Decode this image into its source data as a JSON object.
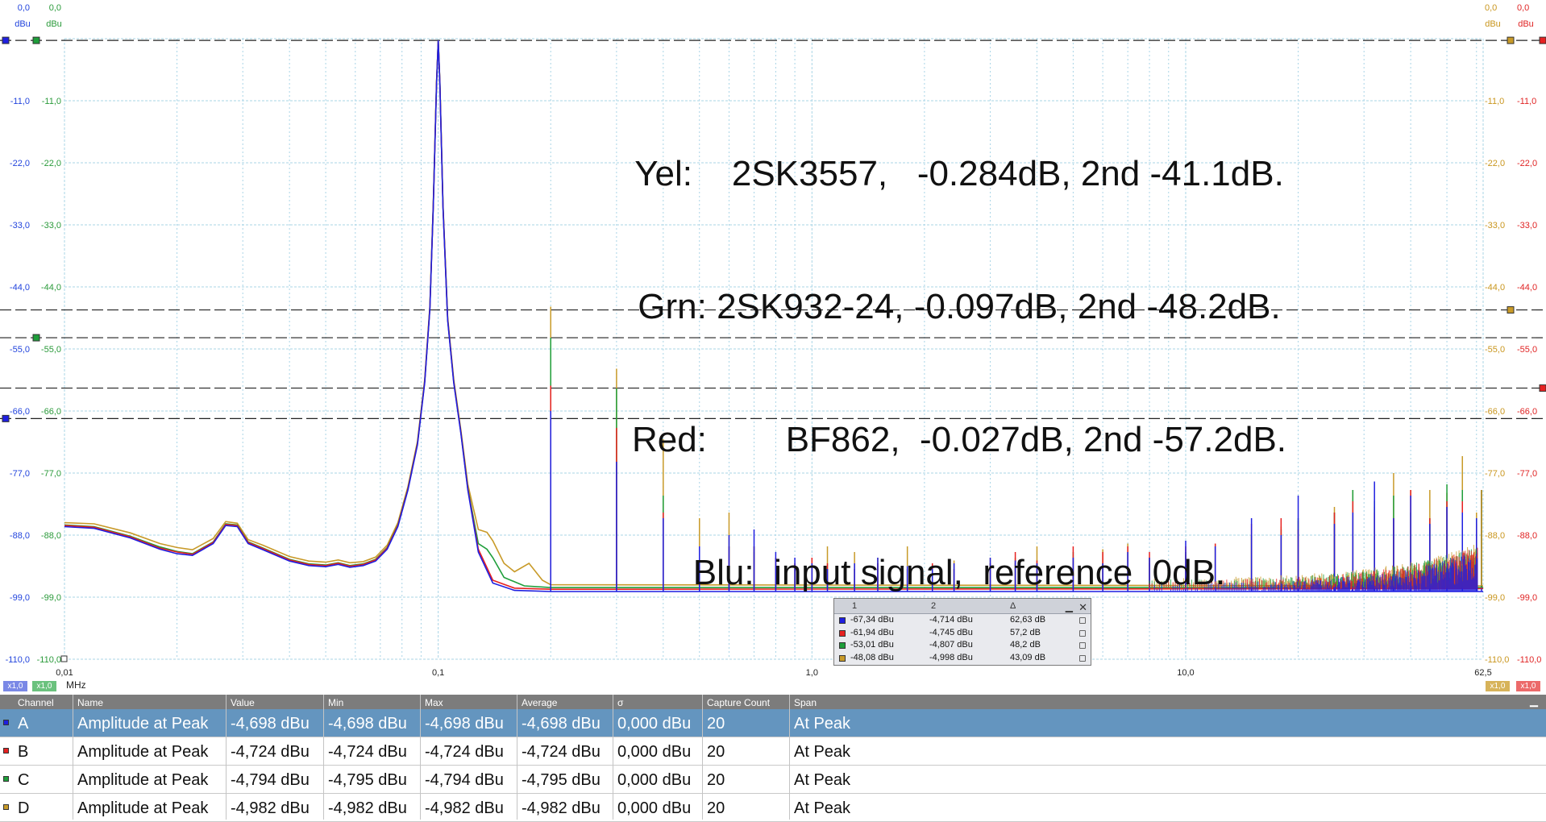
{
  "annotation": {
    "lines": [
      "Yel:    2SK3557,   -0.284dB, 2nd -41.1dB.",
      "Grn: 2SK932-24, -0.097dB, 2nd -48.2dB.",
      "Red:        BF862,  -0.027dB, 2nd -57.2dB.",
      "Blu:  input signal,  reference  0dB."
    ]
  },
  "colors": {
    "A": "#1f1fe0",
    "B": "#e62020",
    "C": "#1e9e3a",
    "D": "#c89a28",
    "left_axis_a": "#2244dd",
    "left_axis_c": "#2a9a3a",
    "right_axis_d": "#c9961e",
    "right_axis_b": "#e02424",
    "grid": "#a9d4e6",
    "table_selected": "#6495bf"
  },
  "chart_data": {
    "type": "line",
    "title": "",
    "xlabel": "MHz",
    "ylabel": "dBu",
    "x_scale": "log",
    "xlim": [
      0.01,
      62.5
    ],
    "ylim": [
      -110,
      0
    ],
    "grid": true,
    "x_tick_labels": [
      "0,01",
      "0,1",
      "1,0",
      "10,0",
      "62,5"
    ],
    "x_ticks": [
      0.01,
      0.1,
      1.0,
      10.0,
      62.5
    ],
    "y_ticks": [
      0,
      -11,
      -22,
      -33,
      -44,
      -55,
      -66,
      -77,
      -88,
      -99,
      -110
    ],
    "y_tick_labels": [
      "0,0",
      "-11,0",
      "-22,0",
      "-33,0",
      "-44,0",
      "-55,0",
      "-66,0",
      "-77,0",
      "-88,0",
      "-99,0",
      "-110,0"
    ],
    "left_axis_units": [
      "dBu",
      "dBu"
    ],
    "right_axis_units": [
      "dBu",
      "dBu"
    ],
    "left_scale_pills": [
      "x1,0",
      "x1,0"
    ],
    "right_scale_pills": [
      "x1,0",
      "x1,0"
    ],
    "noise_floor": {
      "A": -98,
      "B": -97.5,
      "C": -97.3,
      "D": -97.0
    },
    "fundamental": {
      "x": 0.1,
      "y": -0.3
    },
    "series": [
      {
        "id": "A",
        "points": [
          [
            0.01,
            -86.5
          ],
          [
            0.012,
            -86.8
          ],
          [
            0.015,
            -88.5
          ],
          [
            0.018,
            -90.5
          ],
          [
            0.02,
            -91.3
          ],
          [
            0.022,
            -91.6
          ],
          [
            0.025,
            -89.5
          ],
          [
            0.027,
            -86.3
          ],
          [
            0.029,
            -86.5
          ],
          [
            0.031,
            -89.5
          ],
          [
            0.034,
            -90.6
          ],
          [
            0.04,
            -92.6
          ],
          [
            0.045,
            -93.4
          ],
          [
            0.05,
            -93.6
          ],
          [
            0.054,
            -93.2
          ],
          [
            0.058,
            -93.7
          ],
          [
            0.063,
            -93.4
          ],
          [
            0.068,
            -92.6
          ],
          [
            0.073,
            -90.5
          ],
          [
            0.078,
            -86.5
          ],
          [
            0.083,
            -80.0
          ],
          [
            0.088,
            -72.0
          ],
          [
            0.092,
            -61.0
          ],
          [
            0.095,
            -48.0
          ],
          [
            0.097,
            -30.0
          ],
          [
            0.099,
            -8.0
          ],
          [
            0.1,
            -0.3
          ],
          [
            0.101,
            -8.0
          ],
          [
            0.103,
            -30.0
          ],
          [
            0.106,
            -50.0
          ],
          [
            0.11,
            -61.0
          ],
          [
            0.115,
            -70.0
          ],
          [
            0.12,
            -80.0
          ],
          [
            0.128,
            -91.0
          ],
          [
            0.14,
            -96.5
          ],
          [
            0.16,
            -97.8
          ],
          [
            0.2,
            -98.0
          ],
          [
            62.5,
            -98.0
          ]
        ]
      },
      {
        "id": "B",
        "points": [
          [
            0.01,
            -86.3
          ],
          [
            0.012,
            -86.6
          ],
          [
            0.015,
            -88.3
          ],
          [
            0.018,
            -90.3
          ],
          [
            0.02,
            -91.0
          ],
          [
            0.022,
            -91.4
          ],
          [
            0.025,
            -89.3
          ],
          [
            0.027,
            -86.1
          ],
          [
            0.029,
            -86.3
          ],
          [
            0.031,
            -89.3
          ],
          [
            0.034,
            -90.4
          ],
          [
            0.04,
            -92.4
          ],
          [
            0.045,
            -93.2
          ],
          [
            0.05,
            -93.4
          ],
          [
            0.054,
            -93.0
          ],
          [
            0.058,
            -93.5
          ],
          [
            0.063,
            -93.2
          ],
          [
            0.068,
            -92.4
          ],
          [
            0.073,
            -90.3
          ],
          [
            0.078,
            -86.3
          ],
          [
            0.083,
            -79.8
          ],
          [
            0.088,
            -71.8
          ],
          [
            0.092,
            -60.8
          ],
          [
            0.095,
            -47.8
          ],
          [
            0.097,
            -29.8
          ],
          [
            0.099,
            -7.8
          ],
          [
            0.1,
            -0.3
          ],
          [
            0.101,
            -7.8
          ],
          [
            0.103,
            -29.8
          ],
          [
            0.106,
            -49.8
          ],
          [
            0.11,
            -60.8
          ],
          [
            0.115,
            -69.8
          ],
          [
            0.12,
            -79.8
          ],
          [
            0.128,
            -90.5
          ],
          [
            0.14,
            -96.0
          ],
          [
            0.16,
            -97.4
          ],
          [
            0.2,
            -97.6
          ],
          [
            62.5,
            -97.5
          ]
        ]
      },
      {
        "id": "C",
        "points": [
          [
            0.01,
            -86.2
          ],
          [
            0.012,
            -86.5
          ],
          [
            0.015,
            -88.2
          ],
          [
            0.018,
            -90.1
          ],
          [
            0.02,
            -90.9
          ],
          [
            0.022,
            -91.3
          ],
          [
            0.025,
            -89.2
          ],
          [
            0.027,
            -86.0
          ],
          [
            0.029,
            -86.2
          ],
          [
            0.031,
            -89.2
          ],
          [
            0.034,
            -90.3
          ],
          [
            0.04,
            -92.3
          ],
          [
            0.045,
            -93.1
          ],
          [
            0.05,
            -93.3
          ],
          [
            0.054,
            -92.9
          ],
          [
            0.058,
            -93.4
          ],
          [
            0.063,
            -93.1
          ],
          [
            0.068,
            -92.3
          ],
          [
            0.073,
            -90.2
          ],
          [
            0.078,
            -86.2
          ],
          [
            0.083,
            -79.7
          ],
          [
            0.088,
            -71.7
          ],
          [
            0.092,
            -60.7
          ],
          [
            0.095,
            -47.7
          ],
          [
            0.097,
            -29.7
          ],
          [
            0.099,
            -7.7
          ],
          [
            0.1,
            -0.3
          ],
          [
            0.101,
            -7.7
          ],
          [
            0.103,
            -29.7
          ],
          [
            0.106,
            -49.7
          ],
          [
            0.11,
            -60.7
          ],
          [
            0.115,
            -69.7
          ],
          [
            0.12,
            -79.7
          ],
          [
            0.128,
            -89.5
          ],
          [
            0.135,
            -90.5
          ],
          [
            0.14,
            -92.0
          ],
          [
            0.15,
            -95.5
          ],
          [
            0.17,
            -97.0
          ],
          [
            0.2,
            -97.3
          ],
          [
            62.5,
            -97.3
          ]
        ]
      },
      {
        "id": "D",
        "points": [
          [
            0.01,
            -85.8
          ],
          [
            0.012,
            -86.0
          ],
          [
            0.015,
            -87.6
          ],
          [
            0.018,
            -89.5
          ],
          [
            0.02,
            -90.2
          ],
          [
            0.022,
            -90.6
          ],
          [
            0.025,
            -88.6
          ],
          [
            0.027,
            -85.6
          ],
          [
            0.029,
            -85.9
          ],
          [
            0.031,
            -88.8
          ],
          [
            0.034,
            -89.8
          ],
          [
            0.04,
            -91.8
          ],
          [
            0.045,
            -92.6
          ],
          [
            0.05,
            -92.8
          ],
          [
            0.054,
            -92.4
          ],
          [
            0.058,
            -92.9
          ],
          [
            0.063,
            -92.7
          ],
          [
            0.068,
            -91.9
          ],
          [
            0.073,
            -89.8
          ],
          [
            0.078,
            -85.8
          ],
          [
            0.083,
            -79.4
          ],
          [
            0.088,
            -71.4
          ],
          [
            0.092,
            -60.4
          ],
          [
            0.095,
            -47.4
          ],
          [
            0.097,
            -29.4
          ],
          [
            0.099,
            -7.5
          ],
          [
            0.1,
            -0.5
          ],
          [
            0.101,
            -7.5
          ],
          [
            0.103,
            -29.4
          ],
          [
            0.106,
            -49.4
          ],
          [
            0.11,
            -60.4
          ],
          [
            0.115,
            -69.4
          ],
          [
            0.12,
            -79.0
          ],
          [
            0.128,
            -87.0
          ],
          [
            0.135,
            -87.5
          ],
          [
            0.14,
            -89.0
          ],
          [
            0.15,
            -93.0
          ],
          [
            0.16,
            -94.5
          ],
          [
            0.175,
            -93.0
          ],
          [
            0.19,
            -96.0
          ],
          [
            0.2,
            -96.8
          ],
          [
            62.5,
            -97.0
          ]
        ]
      }
    ],
    "harmonics": [
      {
        "f": 0.2,
        "A": -66.0,
        "B": -61.5,
        "C": -53.0,
        "D": -47.5
      },
      {
        "f": 0.3,
        "A": -75.0,
        "B": -69.0,
        "C": -62.0,
        "D": -58.5
      },
      {
        "f": 0.4,
        "A": -85.0,
        "B": -84.0,
        "C": -81.0,
        "D": -71.0
      },
      {
        "f": 0.5,
        "A": -90.0,
        "B": -90.0,
        "C": -90.0,
        "D": -85.0
      },
      {
        "f": 0.6,
        "A": -88.0,
        "B": -90.0,
        "C": -90.0,
        "D": -84.0
      },
      {
        "f": 0.7,
        "A": -87.0,
        "B": -90.0,
        "C": -90.0,
        "D": -91.0
      },
      {
        "f": 0.8,
        "A": -91.0,
        "B": -92.0,
        "C": -93.0,
        "D": -92.0
      },
      {
        "f": 0.9,
        "A": -92.0,
        "B": -93.0,
        "C": -94.0,
        "D": -93.0
      },
      {
        "f": 1.0,
        "A": -93.0,
        "B": -92.0,
        "C": -94.0,
        "D": -93.5
      },
      {
        "f": 1.1,
        "A": -94.0,
        "B": -93.0,
        "C": -94.0,
        "D": -90.0
      },
      {
        "f": 1.3,
        "A": -93.0,
        "B": -94.0,
        "C": -94.0,
        "D": -91.0
      },
      {
        "f": 1.5,
        "A": -92.0,
        "B": -93.0,
        "C": -93.0,
        "D": -92.0
      },
      {
        "f": 1.8,
        "A": -93.5,
        "B": -94.0,
        "C": -94.0,
        "D": -90.0
      },
      {
        "f": 2.1,
        "A": -94.0,
        "B": -93.0,
        "C": -94.0,
        "D": -93.0
      },
      {
        "f": 2.4,
        "A": -93.0,
        "B": -94.0,
        "C": -94.0,
        "D": -92.5
      },
      {
        "f": 3.0,
        "A": -92.0,
        "B": -93.0,
        "C": -93.0,
        "D": -92.0
      },
      {
        "f": 3.5,
        "A": -92.5,
        "B": -91.0,
        "C": -93.0,
        "D": -92.0
      },
      {
        "f": 4.0,
        "A": -93.0,
        "B": -92.5,
        "C": -93.0,
        "D": -90.0
      },
      {
        "f": 5.0,
        "A": -92.0,
        "B": -90.0,
        "C": -91.0,
        "D": -92.5
      },
      {
        "f": 6.0,
        "A": -93.0,
        "B": -91.0,
        "C": -93.0,
        "D": -90.5
      },
      {
        "f": 7.0,
        "A": -91.0,
        "B": -90.0,
        "C": -91.0,
        "D": -89.5
      },
      {
        "f": 8.0,
        "A": -92.0,
        "B": -91.0,
        "C": -92.0,
        "D": -93.0
      },
      {
        "f": 10.0,
        "A": -89.0,
        "B": -90.0,
        "C": -91.0,
        "D": -91.5
      },
      {
        "f": 12.0,
        "A": -90.0,
        "B": -89.5,
        "C": -90.0,
        "D": -89.5
      },
      {
        "f": 15.0,
        "A": -85.0,
        "B": -86.0,
        "C": -88.0,
        "D": -88.0
      },
      {
        "f": 18.0,
        "A": -88.0,
        "B": -85.0,
        "C": -87.0,
        "D": -86.5
      },
      {
        "f": 20.0,
        "A": -81.0,
        "B": -87.0,
        "C": -85.0,
        "D": -85.5
      },
      {
        "f": 25.0,
        "A": -86.0,
        "B": -84.0,
        "C": -84.0,
        "D": -83.0
      },
      {
        "f": 28.0,
        "A": -84.0,
        "B": -82.0,
        "C": -80.0,
        "D": -80.0
      },
      {
        "f": 32.0,
        "A": -78.5,
        "B": -84.0,
        "C": -82.0,
        "D": -83.0
      },
      {
        "f": 36.0,
        "A": -85.0,
        "B": -85.0,
        "C": -81.0,
        "D": -77.0
      },
      {
        "f": 40.0,
        "A": -81.0,
        "B": -80.0,
        "C": -84.0,
        "D": -80.0
      },
      {
        "f": 45.0,
        "A": -86.0,
        "B": -85.0,
        "C": -85.0,
        "D": -80.0
      },
      {
        "f": 50.0,
        "A": -83.0,
        "B": -82.0,
        "C": -79.0,
        "D": -80.5
      },
      {
        "f": 55.0,
        "A": -84.0,
        "B": -82.0,
        "C": -80.0,
        "D": -74.0
      },
      {
        "f": 60.0,
        "A": -85.0,
        "B": -86.0,
        "C": -85.0,
        "D": -84.0
      }
    ],
    "cursors": {
      "A": -67.34,
      "B": -61.94,
      "C": -53.01,
      "D": -48.08,
      "top": -0.3
    }
  },
  "cursor_readout": {
    "headers": [
      "1",
      "2",
      "Δ"
    ],
    "rows": [
      {
        "channel": "A",
        "c1": "-67,34 dBu",
        "c2": "-4,714 dBu",
        "delta": "62,63 dB"
      },
      {
        "channel": "B",
        "c1": "-61,94 dBu",
        "c2": "-4,745 dBu",
        "delta": "57,2 dB"
      },
      {
        "channel": "C",
        "c1": "-53,01 dBu",
        "c2": "-4,807 dBu",
        "delta": "48,2 dB"
      },
      {
        "channel": "D",
        "c1": "-48,08 dBu",
        "c2": "-4,998 dBu",
        "delta": "43,09 dB"
      }
    ]
  },
  "measurements": {
    "columns": [
      "Channel",
      "Name",
      "Value",
      "Min",
      "Max",
      "Average",
      "σ",
      "Capture Count",
      "Span"
    ],
    "rows": [
      {
        "channel": "A",
        "name": "Amplitude at Peak",
        "value": "-4,698 dBu",
        "min": "-4,698 dBu",
        "max": "-4,698 dBu",
        "average": "-4,698 dBu",
        "sigma": "0,000 dBu",
        "count": "20",
        "span": "At Peak",
        "selected": true
      },
      {
        "channel": "B",
        "name": "Amplitude at Peak",
        "value": "-4,724 dBu",
        "min": "-4,724 dBu",
        "max": "-4,724 dBu",
        "average": "-4,724 dBu",
        "sigma": "0,000 dBu",
        "count": "20",
        "span": "At Peak",
        "selected": false
      },
      {
        "channel": "C",
        "name": "Amplitude at Peak",
        "value": "-4,794 dBu",
        "min": "-4,795 dBu",
        "max": "-4,794 dBu",
        "average": "-4,795 dBu",
        "sigma": "0,000 dBu",
        "count": "20",
        "span": "At Peak",
        "selected": false
      },
      {
        "channel": "D",
        "name": "Amplitude at Peak",
        "value": "-4,982 dBu",
        "min": "-4,982 dBu",
        "max": "-4,982 dBu",
        "average": "-4,982 dBu",
        "sigma": "0,000 dBu",
        "count": "20",
        "span": "At Peak",
        "selected": false
      }
    ]
  }
}
